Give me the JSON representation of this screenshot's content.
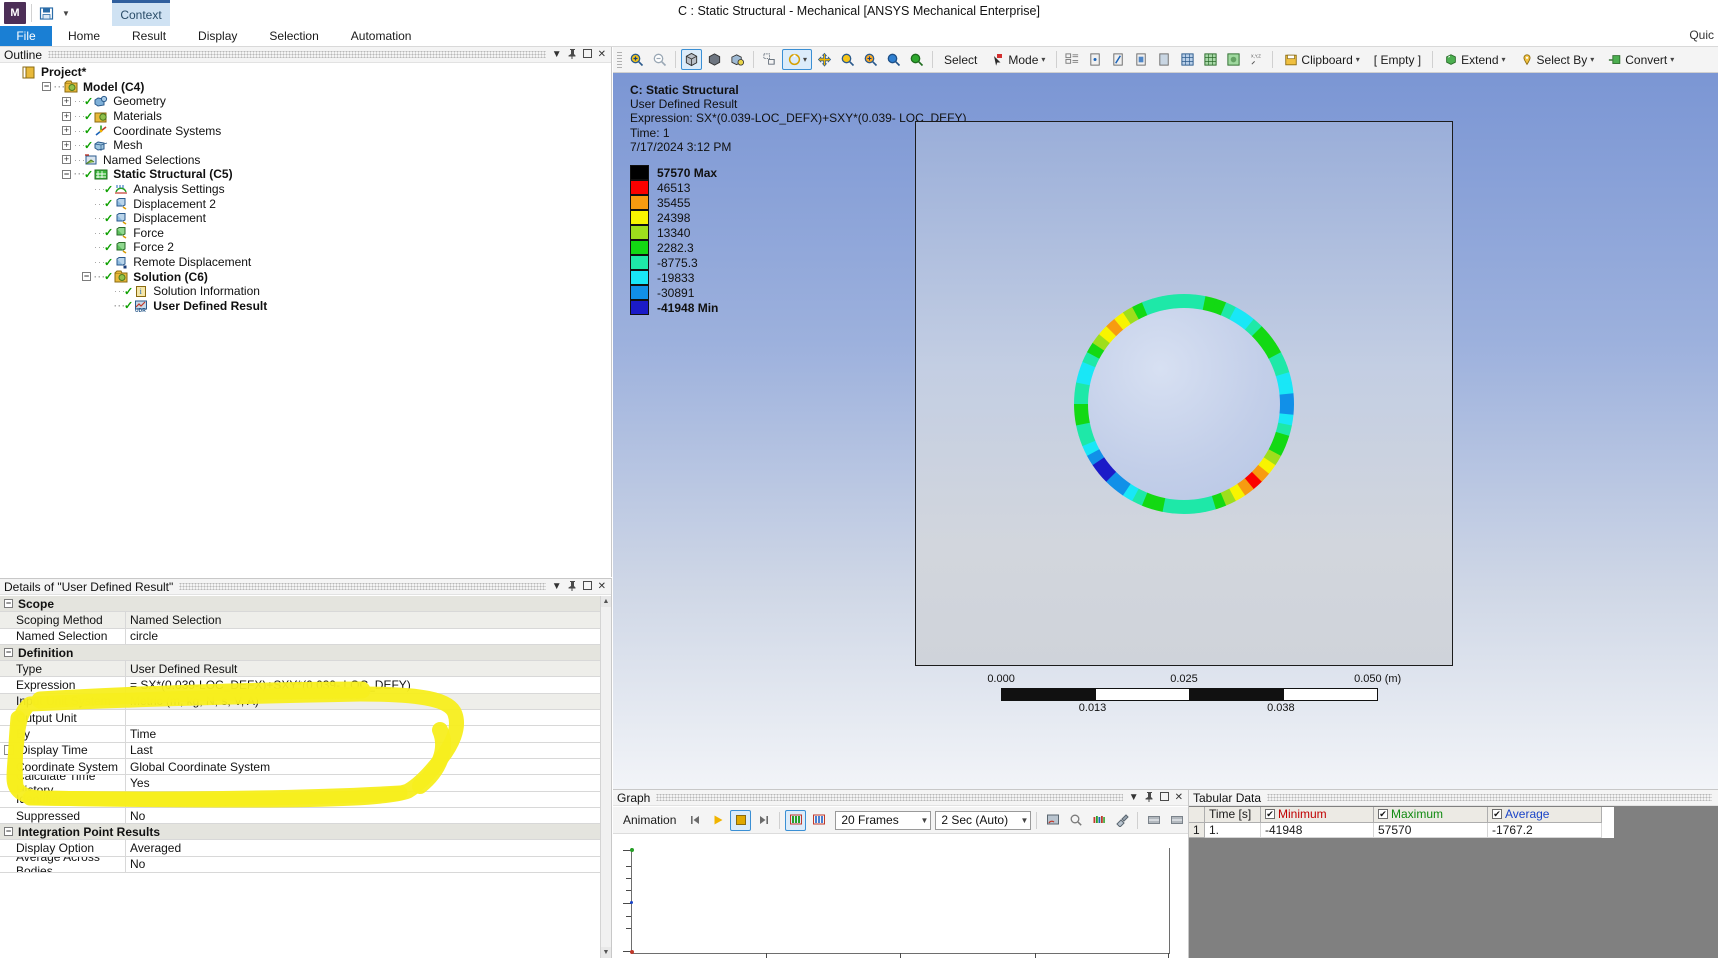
{
  "window": {
    "title": "C : Static Structural - Mechanical [ANSYS Mechanical Enterprise]",
    "app_badge": "M",
    "context_tab": "Context",
    "quick_access": "Quic"
  },
  "ribbon": {
    "file": "File",
    "tabs": [
      "Home",
      "Result",
      "Display",
      "Selection",
      "Automation"
    ]
  },
  "outline": {
    "title": "Outline",
    "tree": [
      {
        "label": "Project*",
        "depth": 0,
        "bold": true,
        "expander": "",
        "check": false,
        "icon": "project-icon"
      },
      {
        "label": "Model (C4)",
        "depth": 1,
        "bold": true,
        "expander": "−",
        "check": false,
        "icon": "model-icon"
      },
      {
        "label": "Geometry",
        "depth": 2,
        "bold": false,
        "expander": "+",
        "check": true,
        "icon": "geometry-icon"
      },
      {
        "label": "Materials",
        "depth": 2,
        "bold": false,
        "expander": "+",
        "check": true,
        "icon": "materials-icon"
      },
      {
        "label": "Coordinate Systems",
        "depth": 2,
        "bold": false,
        "expander": "+",
        "check": true,
        "icon": "coordinate-systems-icon"
      },
      {
        "label": "Mesh",
        "depth": 2,
        "bold": false,
        "expander": "+",
        "check": true,
        "icon": "mesh-icon"
      },
      {
        "label": "Named Selections",
        "depth": 2,
        "bold": false,
        "expander": "+",
        "check": false,
        "icon": "named-selections-icon"
      },
      {
        "label": "Static Structural (C5)",
        "depth": 2,
        "bold": true,
        "expander": "−",
        "check": true,
        "icon": "static-structural-icon"
      },
      {
        "label": "Analysis Settings",
        "depth": 3,
        "bold": false,
        "expander": "",
        "check": true,
        "icon": "analysis-settings-icon"
      },
      {
        "label": "Displacement 2",
        "depth": 3,
        "bold": false,
        "expander": "",
        "check": true,
        "icon": "displacement-icon"
      },
      {
        "label": "Displacement",
        "depth": 3,
        "bold": false,
        "expander": "",
        "check": true,
        "icon": "displacement-icon"
      },
      {
        "label": "Force",
        "depth": 3,
        "bold": false,
        "expander": "",
        "check": true,
        "icon": "force-icon"
      },
      {
        "label": "Force 2",
        "depth": 3,
        "bold": false,
        "expander": "",
        "check": true,
        "icon": "force-icon"
      },
      {
        "label": "Remote Displacement",
        "depth": 3,
        "bold": false,
        "expander": "",
        "check": true,
        "icon": "remote-displacement-icon"
      },
      {
        "label": "Solution (C6)",
        "depth": 3,
        "bold": true,
        "expander": "−",
        "check": true,
        "icon": "solution-icon"
      },
      {
        "label": "Solution Information",
        "depth": 4,
        "bold": false,
        "expander": "",
        "check": true,
        "icon": "solution-information-icon"
      },
      {
        "label": "User Defined Result",
        "depth": 4,
        "bold": true,
        "expander": "",
        "check": true,
        "icon": "user-defined-result-icon"
      }
    ]
  },
  "details": {
    "title": "Details of \"User Defined Result\"",
    "rows": [
      {
        "kind": "group",
        "label": "Scope"
      },
      {
        "kind": "row",
        "label": "Scoping Method",
        "value": "Named Selection",
        "alt": true
      },
      {
        "kind": "row",
        "label": "Named Selection",
        "value": "circle",
        "alt": false
      },
      {
        "kind": "group",
        "label": "Definition"
      },
      {
        "kind": "row",
        "label": "Type",
        "value": "User Defined Result",
        "alt": true
      },
      {
        "kind": "row",
        "label": "Expression",
        "value": "= SX*(0.039-LOC_DEFX)+SXY*(0.039- LOC_DEFY)",
        "alt": false
      },
      {
        "kind": "row",
        "label": "Input Unit System",
        "value": "Metric (m, kg, N, s, V, A)",
        "alt": true
      },
      {
        "kind": "row",
        "label": "Output Unit",
        "value": "",
        "alt": false
      },
      {
        "kind": "row",
        "label": "By",
        "value": "Time",
        "alt": false
      },
      {
        "kind": "check",
        "label": "Display Time",
        "value": "Last",
        "alt": false,
        "checked": false
      },
      {
        "kind": "row",
        "label": "Coordinate System",
        "value": "Global Coordinate System",
        "alt": false
      },
      {
        "kind": "row",
        "label": "Calculate Time History",
        "value": "Yes",
        "alt": false
      },
      {
        "kind": "row",
        "label": "Identifier",
        "value": "",
        "alt": false
      },
      {
        "kind": "row",
        "label": "Suppressed",
        "value": "No",
        "alt": false
      },
      {
        "kind": "group",
        "label": "Integration Point Results"
      },
      {
        "kind": "row",
        "label": "Display Option",
        "value": "Averaged",
        "alt": false
      },
      {
        "kind": "row",
        "label": "Average Across Bodies",
        "value": "No",
        "alt": false
      }
    ]
  },
  "graphics_toolbar": {
    "select_label": "Select",
    "mode_label": "Mode",
    "clipboard_label": "Clipboard",
    "empty_label": "[ Empty ]",
    "extend_label": "Extend",
    "select_by_label": "Select By",
    "convert_label": "Convert",
    "icons": [
      "zoom-in-icon",
      "zoom-out-icon",
      "iso-view-icon",
      "shaded-body-icon",
      "wireframe-icon",
      "box-zoom-icon",
      "rotate-icon",
      "pan-icon",
      "zoom-region-icon",
      "zoom-to-fit-icon",
      "magnify-icon",
      "previous-view-icon"
    ]
  },
  "viewport": {
    "heading": "C: Static Structural",
    "subheading": "User Defined Result",
    "expression": "Expression: SX*(0.039-LOC_DEFX)+SXY*(0.039- LOC_DEFY)",
    "time": "Time: 1",
    "timestamp": "7/17/2024 3:12 PM",
    "legend": [
      {
        "value": "57570 Max",
        "color": "#000000",
        "bold": true
      },
      {
        "value": "46513",
        "color": "#fb0000",
        "bold": false
      },
      {
        "value": "35455",
        "color": "#f79b10",
        "bold": false
      },
      {
        "value": "24398",
        "color": "#f8f400",
        "bold": false
      },
      {
        "value": "13340",
        "color": "#9ede1c",
        "bold": false
      },
      {
        "value": "2282.3",
        "color": "#13d913",
        "bold": false
      },
      {
        "value": "-8775.3",
        "color": "#1ee8a8",
        "bold": false
      },
      {
        "value": "-19833",
        "color": "#19e7f7",
        "bold": false
      },
      {
        "value": "-30891",
        "color": "#1190e8",
        "bold": false
      },
      {
        "value": "-41948 Min",
        "color": "#1b1bc8",
        "bold": true
      }
    ],
    "scale": {
      "top_ticks": [
        "0.000",
        "0.025",
        "0.050 (m)"
      ],
      "bottom_ticks": [
        "0.013",
        "0.038"
      ]
    }
  },
  "graph": {
    "title": "Graph",
    "animation_label": "Animation",
    "frames": "20 Frames",
    "duration": "2 Sec (Auto)",
    "buttons": [
      "first-frame-icon",
      "play-icon",
      "stop-icon",
      "last-frame-icon",
      "distribute-icon",
      "single-icon",
      "save-animation-icon",
      "search-icon",
      "bar-chart-icon",
      "brush-icon",
      "film-start-icon",
      "film-end-icon",
      "timeline-icon"
    ]
  },
  "tabular": {
    "title": "Tabular Data",
    "headers": [
      "",
      "Time [s]",
      "Minimum",
      "Maximum",
      "Average"
    ],
    "header_checks": [
      false,
      false,
      true,
      true,
      true
    ],
    "rows": [
      {
        "index": "1",
        "time": "1.",
        "minimum": "-41948",
        "maximum": "57570",
        "average": "-1767.2"
      }
    ]
  },
  "annotation": {
    "color": "#f7ee1d",
    "description": "hand-drawn highlighter loop around Definition section"
  },
  "panel_controls": {
    "dropdown": "▼",
    "pin": "⚲",
    "maximize": "❐",
    "close": "✕"
  }
}
